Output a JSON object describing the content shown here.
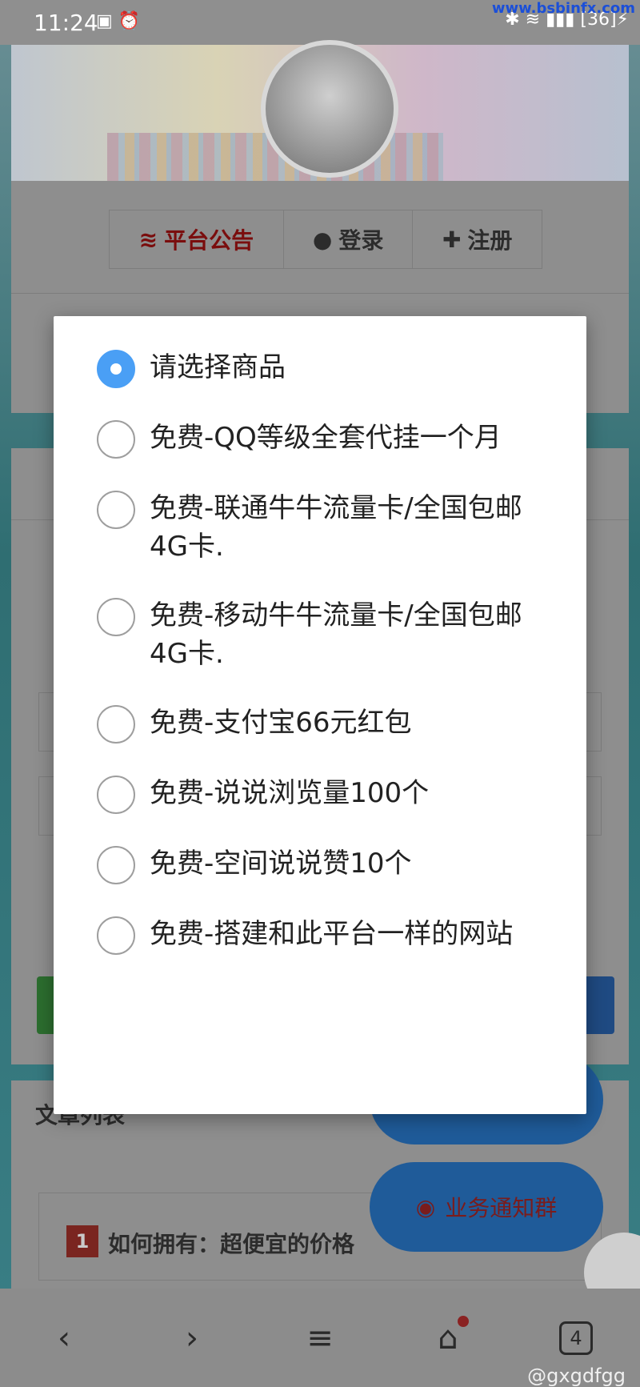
{
  "status_bar": {
    "time": "11:24",
    "battery": "36",
    "watermark_url": "www.bsbinfx.com"
  },
  "nav_tabs": [
    {
      "label": "平台公告",
      "icon": "wifi-icon"
    },
    {
      "label": "登录",
      "icon": "user-icon"
    },
    {
      "label": "注册",
      "icon": "plus-icon"
    }
  ],
  "article_list": {
    "title": "文章列表",
    "first_item_number": "1",
    "first_item_text": "如何拥有：超便宜的价格"
  },
  "float_buttons": {
    "notify_group": "业务通知群"
  },
  "dialog": {
    "selected_index": 0,
    "accent_color": "#4a9ff5",
    "options": [
      "请选择商品",
      "免费-QQ等级全套代挂一个月",
      "免费-联通牛牛流量卡/全国包邮4G卡.",
      "免费-移动牛牛流量卡/全国包邮4G卡.",
      "免费-支付宝66元红包",
      "免费-说说浏览量100个",
      "免费-空间说说赞10个",
      "免费-搭建和此平台一样的网站"
    ]
  },
  "bottom_nav": {
    "tab_count": "4"
  },
  "watermark": "@gxgdfgg"
}
